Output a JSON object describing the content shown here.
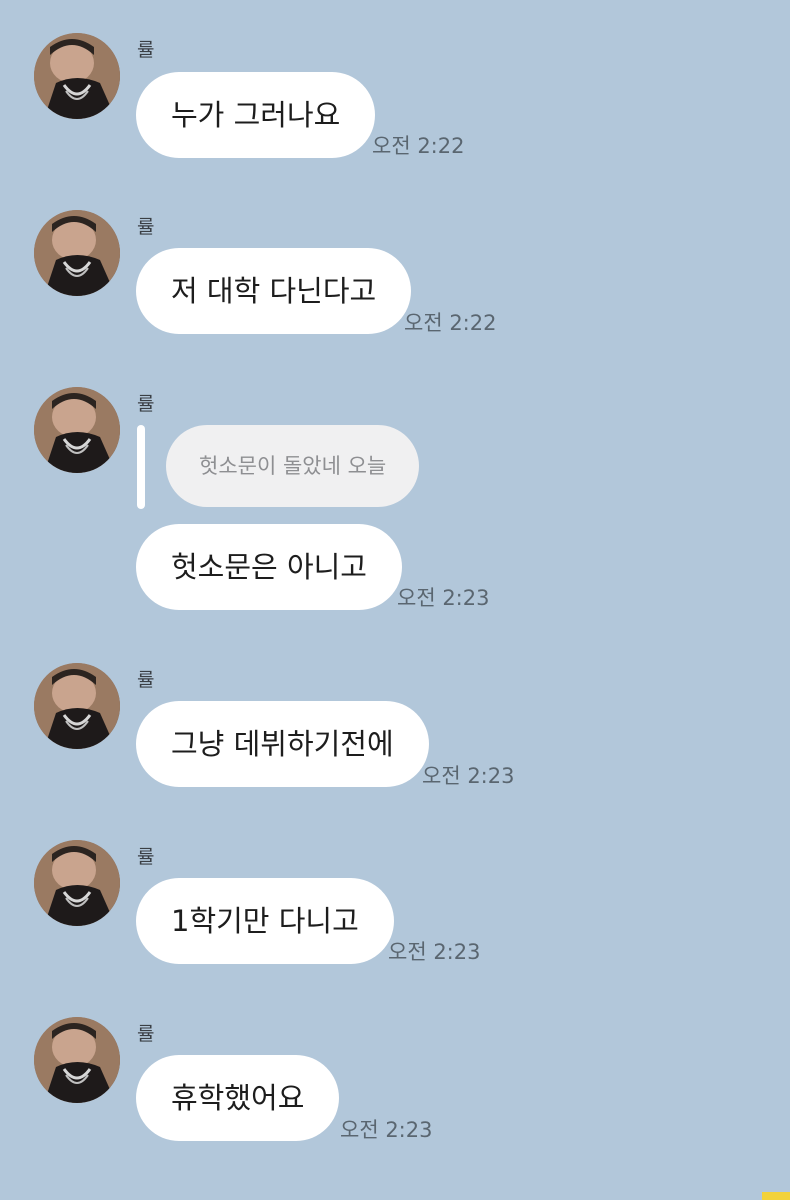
{
  "colors": {
    "background": "#b2c7da",
    "bubble": "#ffffff",
    "reply_bubble": "#f0f0f1",
    "time_text": "#5a6670"
  },
  "messages": [
    {
      "sender": "률",
      "text": "누가 그러나요",
      "time": "오전 2:22"
    },
    {
      "sender": "률",
      "text": "저 대학 다닌다고",
      "time": "오전 2:22"
    },
    {
      "sender": "률",
      "reply_quote": "헛소문이 돌았네 오늘",
      "text": "헛소문은 아니고",
      "time": "오전 2:23"
    },
    {
      "sender": "률",
      "text": "그냥 데뷔하기전에",
      "time": "오전 2:23"
    },
    {
      "sender": "률",
      "text": "1학기만 다니고",
      "time": "오전 2:23"
    },
    {
      "sender": "률",
      "text": "휴학했어요",
      "time": "오전 2:23"
    }
  ],
  "icons": {
    "avatar": "profile-photo"
  }
}
